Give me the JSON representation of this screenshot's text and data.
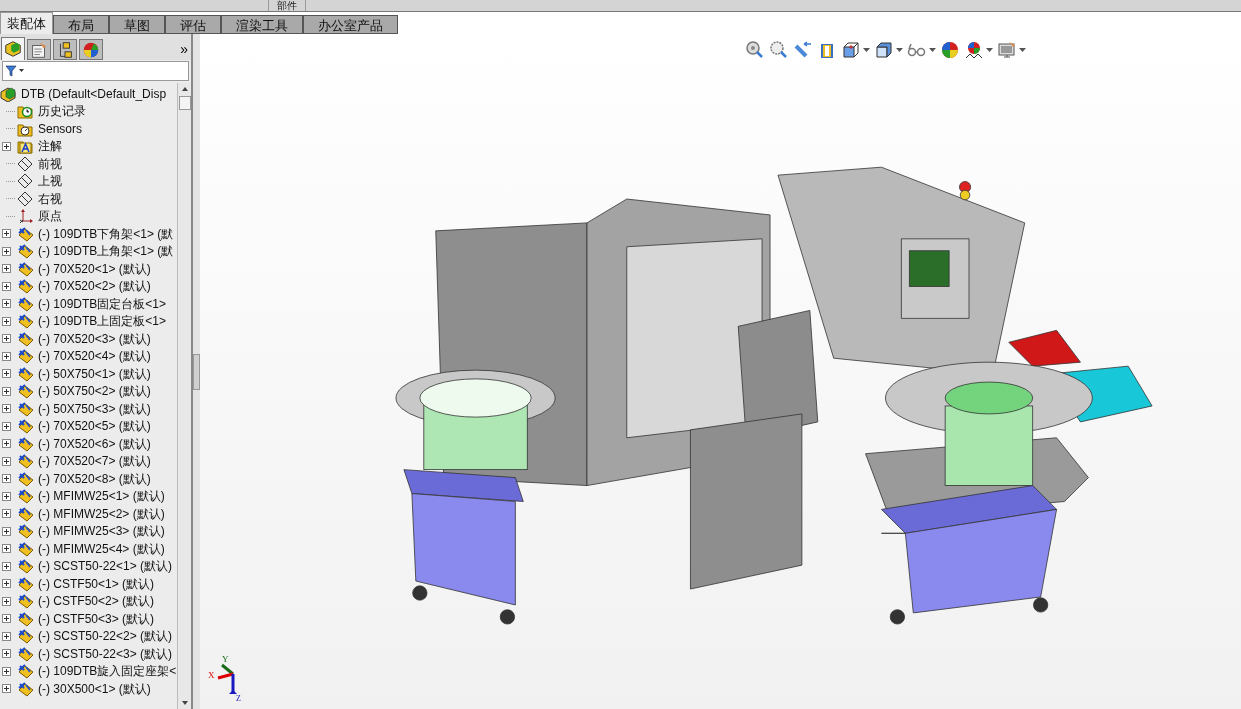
{
  "command_manager": {
    "top_label": "部件",
    "tabs": [
      {
        "label": "装配体",
        "selected": true
      },
      {
        "label": "布局",
        "selected": false
      },
      {
        "label": "草图",
        "selected": false
      },
      {
        "label": "评估",
        "selected": false
      },
      {
        "label": "渲染工具",
        "selected": false
      },
      {
        "label": "办公室产品",
        "selected": false
      }
    ]
  },
  "feature_manager": {
    "panel_tabs": [
      {
        "kind": "feature-tree",
        "selected": true
      },
      {
        "kind": "property",
        "selected": false
      },
      {
        "kind": "configuration",
        "selected": false
      },
      {
        "kind": "appearance",
        "selected": false
      }
    ],
    "more": "»",
    "tree": {
      "label": "DTB  (Default<Default_Disp",
      "kind": "assembly",
      "expanded": true,
      "children": [
        {
          "label": "历史记录",
          "kind": "history",
          "expandable": false
        },
        {
          "label": "Sensors",
          "kind": "sensors",
          "expandable": false
        },
        {
          "label": "注解",
          "kind": "annotation",
          "expandable": true
        },
        {
          "label": "前视",
          "kind": "plane",
          "expandable": false
        },
        {
          "label": "上视",
          "kind": "plane",
          "expandable": false
        },
        {
          "label": "右视",
          "kind": "plane",
          "expandable": false
        },
        {
          "label": "原点",
          "kind": "origin",
          "expandable": false
        },
        {
          "label": "(-) 109DTB下角架<1> (默",
          "kind": "part",
          "expandable": true
        },
        {
          "label": "(-) 109DTB上角架<1> (默",
          "kind": "part",
          "expandable": true
        },
        {
          "label": "(-) 70X520<1> (默认)",
          "kind": "part",
          "expandable": true
        },
        {
          "label": "(-) 70X520<2> (默认)",
          "kind": "part",
          "expandable": true
        },
        {
          "label": "(-) 109DTB固定台板<1>",
          "kind": "part",
          "expandable": true
        },
        {
          "label": "(-) 109DTB上固定板<1>",
          "kind": "part",
          "expandable": true
        },
        {
          "label": "(-) 70X520<3> (默认)",
          "kind": "part",
          "expandable": true
        },
        {
          "label": "(-) 70X520<4> (默认)",
          "kind": "part",
          "expandable": true
        },
        {
          "label": "(-) 50X750<1> (默认)",
          "kind": "part",
          "expandable": true
        },
        {
          "label": "(-) 50X750<2> (默认)",
          "kind": "part",
          "expandable": true
        },
        {
          "label": "(-) 50X750<3> (默认)",
          "kind": "part",
          "expandable": true
        },
        {
          "label": "(-) 70X520<5> (默认)",
          "kind": "part",
          "expandable": true
        },
        {
          "label": "(-) 70X520<6> (默认)",
          "kind": "part",
          "expandable": true
        },
        {
          "label": "(-) 70X520<7> (默认)",
          "kind": "part",
          "expandable": true
        },
        {
          "label": "(-) 70X520<8> (默认)",
          "kind": "part",
          "expandable": true
        },
        {
          "label": "(-) MFIMW25<1> (默认)",
          "kind": "part",
          "expandable": true
        },
        {
          "label": "(-) MFIMW25<2> (默认)",
          "kind": "part",
          "expandable": true
        },
        {
          "label": "(-) MFIMW25<3> (默认)",
          "kind": "part",
          "expandable": true
        },
        {
          "label": "(-) MFIMW25<4> (默认)",
          "kind": "part",
          "expandable": true
        },
        {
          "label": "(-) SCST50-22<1> (默认)",
          "kind": "part",
          "expandable": true
        },
        {
          "label": "(-) CSTF50<1> (默认)",
          "kind": "part",
          "expandable": true
        },
        {
          "label": "(-) CSTF50<2> (默认)",
          "kind": "part",
          "expandable": true
        },
        {
          "label": "(-) CSTF50<3> (默认)",
          "kind": "part",
          "expandable": true
        },
        {
          "label": "(-) SCST50-22<2> (默认)",
          "kind": "part",
          "expandable": true
        },
        {
          "label": "(-) SCST50-22<3> (默认)",
          "kind": "part",
          "expandable": true
        },
        {
          "label": "(-) 109DTB旋入固定座架<",
          "kind": "part",
          "expandable": true
        },
        {
          "label": "(-) 30X500<1> (默认)",
          "kind": "part",
          "expandable": true
        }
      ]
    }
  },
  "viewport": {
    "toolbar": [
      {
        "kind": "zoom-fit",
        "dropdown": false
      },
      {
        "kind": "zoom-area",
        "dropdown": false
      },
      {
        "kind": "previous-view",
        "dropdown": false
      },
      {
        "kind": "section-view",
        "dropdown": false
      },
      {
        "kind": "view-orientation",
        "dropdown": true
      },
      {
        "kind": "display-style",
        "dropdown": true
      },
      {
        "kind": "hide-show",
        "dropdown": true
      },
      {
        "kind": "appearance",
        "dropdown": false
      },
      {
        "kind": "scene",
        "dropdown": true
      },
      {
        "kind": "display-settings",
        "dropdown": true
      }
    ],
    "triad": {
      "x": "X",
      "y": "Y",
      "z": "Z"
    }
  }
}
